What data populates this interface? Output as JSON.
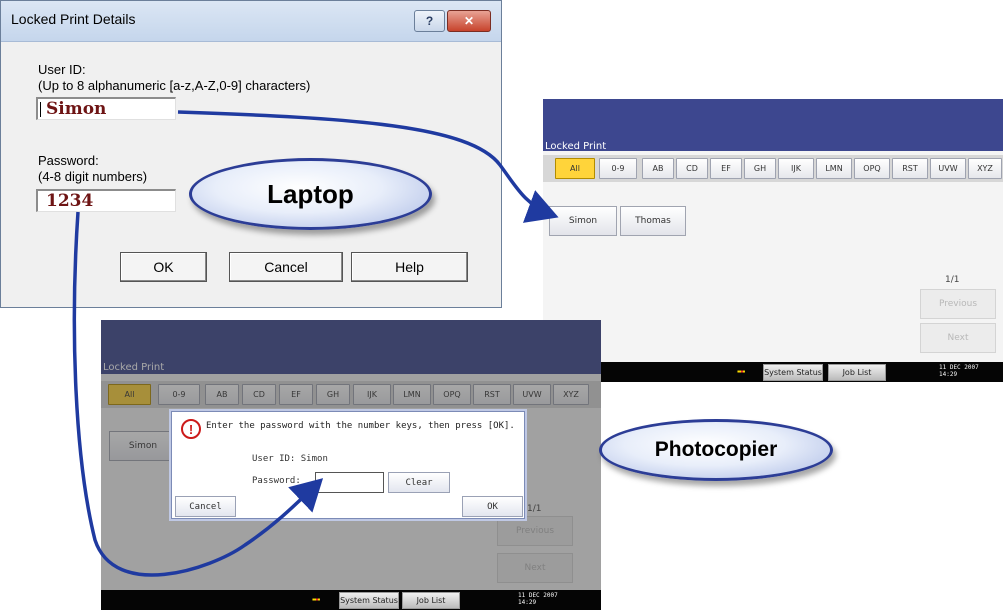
{
  "dialog": {
    "title": "Locked Print Details",
    "help_button": "?",
    "close_button": "✕",
    "user_id_label": "User ID:",
    "user_id_hint": "(Up to 8 alphanumeric [a-z,A-Z,0-9] characters)",
    "user_id_value": "Simon",
    "password_label": "Password:",
    "password_hint": "(4-8 digit numbers)",
    "password_value": "1234",
    "ok_label": "OK",
    "cancel_label": "Cancel",
    "help_label": "Help"
  },
  "callouts": {
    "laptop": "Laptop",
    "photocopier": "Photocopier"
  },
  "copier_top": {
    "title": "Locked Print",
    "tabs": [
      "All",
      "0-9",
      "AB",
      "CD",
      "EF",
      "GH",
      "IJK",
      "LMN",
      "OPQ",
      "RST",
      "UVW",
      "XYZ"
    ],
    "users": [
      "Simon",
      "Thomas"
    ],
    "page": "1/1",
    "previous_label": "Previous",
    "next_label": "Next",
    "system_status_label": "System Status",
    "job_list_label": "Job List",
    "clock_date": "11 DEC 2007",
    "clock_time": "14:29"
  },
  "copier_bottom": {
    "title": "Locked Print",
    "tabs": [
      "All",
      "0-9",
      "AB",
      "CD",
      "EF",
      "GH",
      "IJK",
      "LMN",
      "OPQ",
      "RST",
      "UVW",
      "XYZ"
    ],
    "users": [
      "Simon"
    ],
    "page": "1/1",
    "previous_label": "Previous",
    "next_label": "Next",
    "system_status_label": "System Status",
    "job_list_label": "Job List",
    "clock_date": "11 DEC 2007",
    "clock_time": "14:29"
  },
  "popup": {
    "message": "Enter the password with the number keys, then press [OK].",
    "user_id_text": "User ID:  Simon",
    "password_label": "Password:",
    "clear_label": "Clear",
    "cancel_label": "Cancel",
    "ok_label": "OK"
  },
  "colors": {
    "copier_header": "#3d478f",
    "tab_selected": "#ffd43a",
    "arrow": "#1f3aa0",
    "oval_border": "#2c3d96",
    "input_text": "#6e1414"
  }
}
